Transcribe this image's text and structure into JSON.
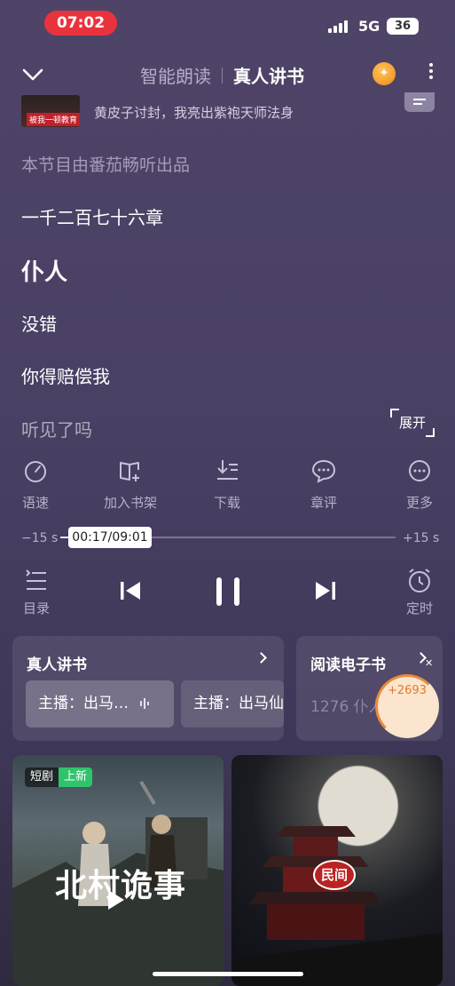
{
  "status_bar": {
    "time": "07:02",
    "network": "5G",
    "battery": "36"
  },
  "header": {
    "tab_smart": "智能朗读",
    "tab_human": "真人讲书"
  },
  "book": {
    "thumb_text": "被我一顿教育",
    "title": "黄皮子讨封，我亮出紫袍天师法身"
  },
  "transcript": {
    "lines": [
      "本节目由番茄畅听出品",
      "一千二百七十六章",
      "仆人",
      "没错",
      "你得赔偿我",
      "听见了吗"
    ],
    "expand_label": "展开"
  },
  "actions": [
    {
      "label": "语速",
      "icon": "speed-icon"
    },
    {
      "label": "加入书架",
      "icon": "add-bookshelf-icon"
    },
    {
      "label": "下载",
      "icon": "download-icon"
    },
    {
      "label": "章评",
      "icon": "comment-icon"
    },
    {
      "label": "更多",
      "icon": "more-icon"
    }
  ],
  "progress": {
    "back_label": "−15 s",
    "forward_label": "+15 s",
    "time_display": "00:17/09:01",
    "fraction": 0.031
  },
  "controls": {
    "catalog_label": "目录",
    "timer_label": "定时"
  },
  "cards": {
    "human_title": "真人讲书",
    "anchors": [
      "主播：出马…",
      "主播：出马仙"
    ],
    "ebook_title": "阅读电子书",
    "ebook_count": "1276 仆人",
    "bonus": "+2693"
  },
  "posters": [
    {
      "tag1": "短剧",
      "tag2": "上新",
      "title": "北村诡事"
    },
    {
      "badge": "民间"
    }
  ],
  "colors": {
    "background": "#4a4064",
    "accent_red": "#e8333c",
    "accent_green": "#2fc46b",
    "bonus_orange": "#e47a22"
  }
}
